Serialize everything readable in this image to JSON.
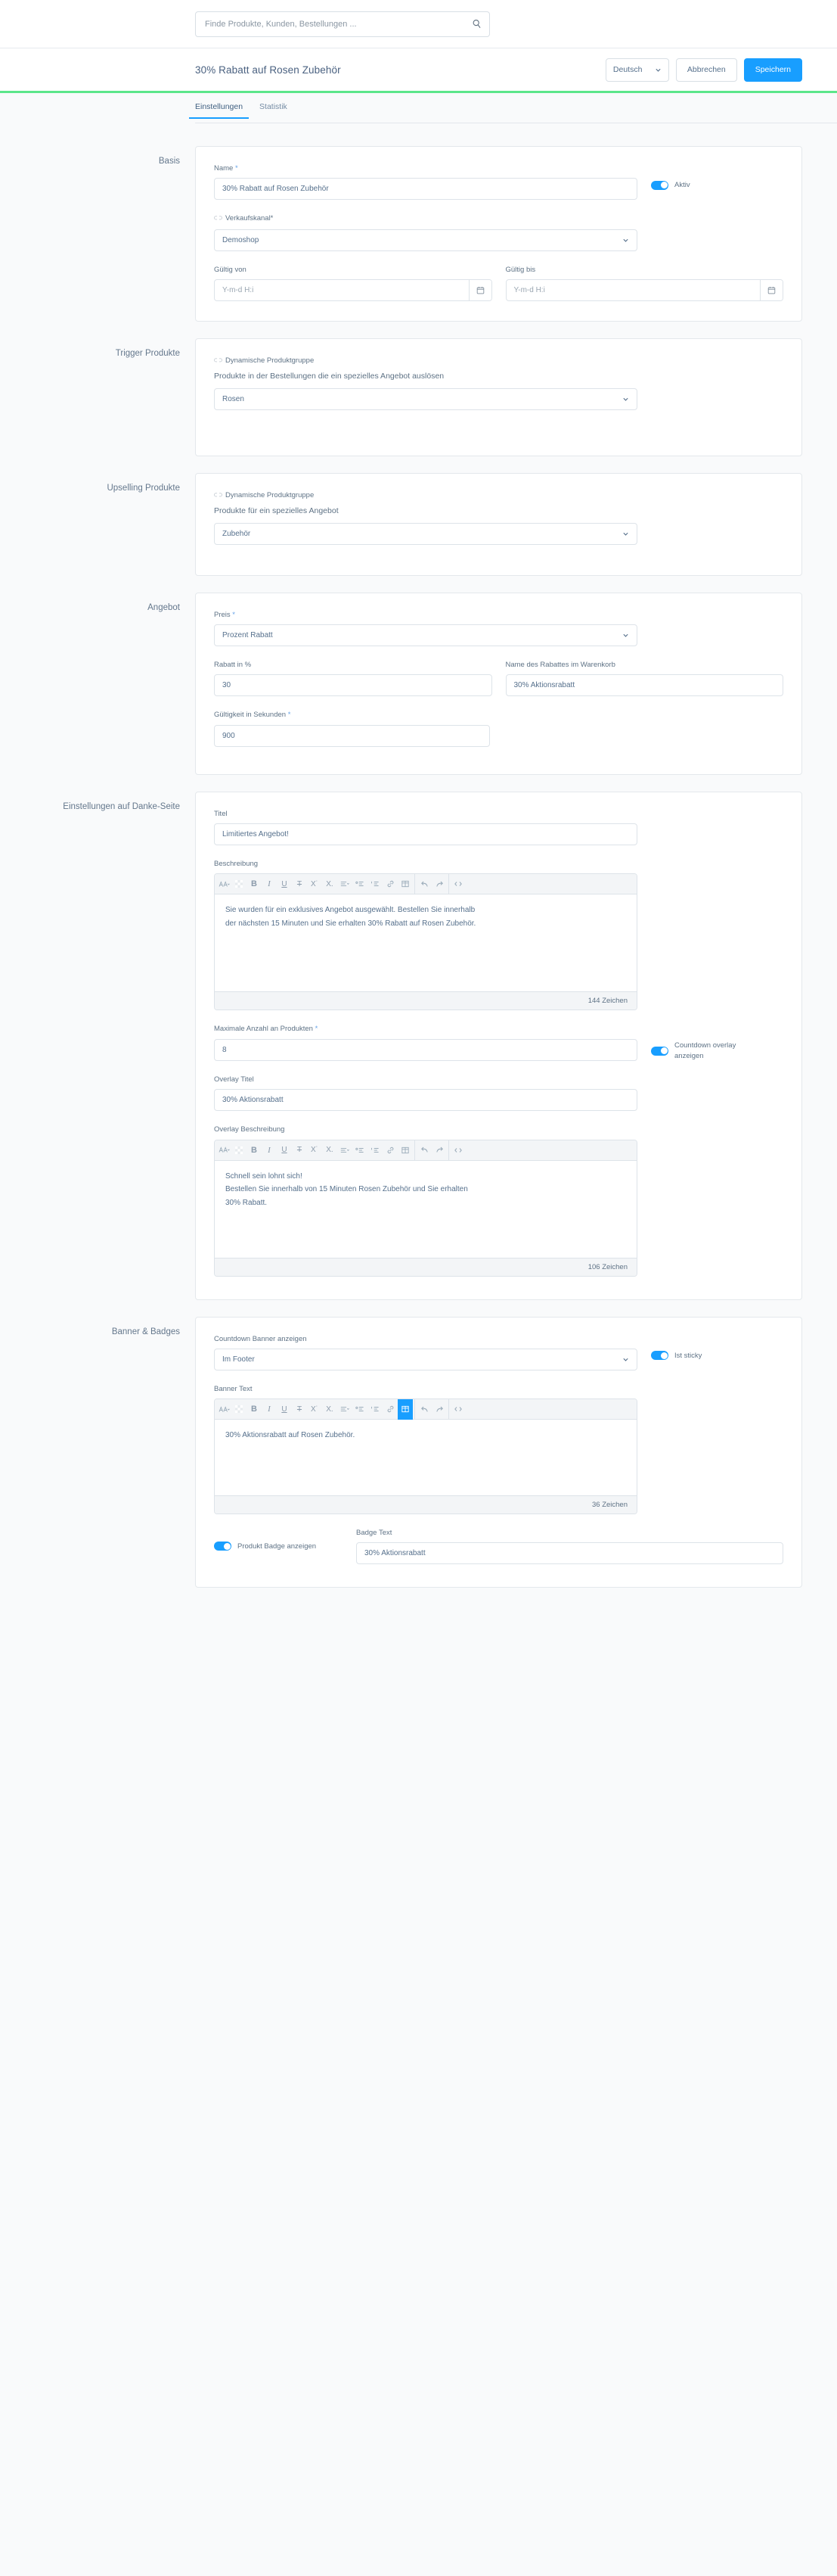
{
  "search": {
    "placeholder": "Finde Produkte, Kunden, Bestellungen ...",
    "icon": "search-icon"
  },
  "header": {
    "title": "30% Rabatt auf Rosen Zubehör",
    "language": "Deutsch",
    "cancel_label": "Abbrechen",
    "save_label": "Speichern",
    "accent_color": "#189eff",
    "status_bar_color": "#5ce68a"
  },
  "tabs": [
    {
      "label": "Einstellungen",
      "active": true
    },
    {
      "label": "Statistik",
      "active": false
    }
  ],
  "sections": {
    "basis": {
      "label": "Basis",
      "name_label": "Name",
      "name_value": "30% Rabatt auf Rosen Zubehör",
      "active_toggle_label": "Aktiv",
      "sales_channel_label": "Verkaufskanal*",
      "sales_channel_value": "Demoshop",
      "valid_from_label": "Gültig von",
      "valid_from_placeholder": "Y-m-d H:i",
      "valid_to_label": "Gültig bis",
      "valid_to_placeholder": "Y-m-d H:i"
    },
    "trigger": {
      "label": "Trigger Produkte",
      "inherit_label": "Dynamische Produktgruppe",
      "field_label": "Produkte in der Bestellungen die ein spezielles Angebot auslösen",
      "value": "Rosen"
    },
    "upselling": {
      "label": "Upselling Produkte",
      "inherit_label": "Dynamische Produktgruppe",
      "field_label": "Produkte für ein spezielles Angebot",
      "value": "Zubehör"
    },
    "angebot": {
      "label": "Angebot",
      "price_label": "Preis",
      "price_value": "Prozent Rabatt",
      "discount_label": "Rabatt in %",
      "discount_value": "30",
      "cart_name_label": "Name des Rabattes im Warenkorb",
      "cart_name_value": "30% Aktionsrabatt",
      "validity_label": "Gültigkeit in Sekunden",
      "validity_value": "900"
    },
    "thankyou": {
      "label": "Einstellungen auf Danke-Seite",
      "title_label": "Titel",
      "title_value": "Limitiertes Angebot!",
      "description_label": "Beschreibung",
      "description_line1": "Sie wurden für ein exklusives Angebot ausgewählt. Bestellen Sie innerhalb",
      "description_line2": "der nächsten 15 Minuten und Sie erhalten 30% Rabatt auf Rosen Zubehör.",
      "description_counter": "144 Zeichen",
      "max_products_label": "Maximale Anzahl an Produkten",
      "max_products_value": "8",
      "countdown_overlay_label": "Countdown overlay anzeigen",
      "overlay_title_label": "Overlay Titel",
      "overlay_title_value": "30% Aktionsrabatt",
      "overlay_desc_label": "Overlay Beschreibung",
      "overlay_desc_line1": "Schnell sein lohnt sich!",
      "overlay_desc_line2": "Bestellen Sie innerhalb von 15 Minuten Rosen Zubehör und Sie erhalten",
      "overlay_desc_line3": "30% Rabatt.",
      "overlay_desc_counter": "106 Zeichen"
    },
    "banner": {
      "label": "Banner & Badges",
      "countdown_banner_label": "Countdown Banner anzeigen",
      "countdown_banner_value": "Im Footer",
      "sticky_label": "Ist sticky",
      "banner_text_label": "Banner Text",
      "banner_text_value": "30% Aktionsrabatt auf Rosen Zubehör.",
      "banner_text_counter": "36 Zeichen",
      "product_badge_label": "Produkt Badge anzeigen",
      "badge_text_label": "Badge Text",
      "badge_text_value": "30% Aktionsrabatt"
    }
  },
  "editor_toolbar": [
    {
      "name": "font-format-icon",
      "glyph": "𝔸"
    },
    {
      "name": "text-color-icon",
      "glyph": "▨"
    },
    {
      "name": "bold-icon",
      "glyph": "B"
    },
    {
      "name": "italic-icon",
      "glyph": "I"
    },
    {
      "name": "underline-icon",
      "glyph": "U"
    },
    {
      "name": "strikethrough-icon",
      "glyph": "T"
    },
    {
      "name": "superscript-icon",
      "glyph": "X˙"
    },
    {
      "name": "subscript-icon",
      "glyph": "X."
    },
    {
      "name": "align-icon",
      "glyph": "≡"
    },
    {
      "name": "bullet-list-icon",
      "glyph": "⁐"
    },
    {
      "name": "numbered-list-icon",
      "glyph": "1≡"
    },
    {
      "name": "link-icon",
      "glyph": "⛓"
    },
    {
      "name": "table-icon",
      "glyph": "⊞"
    },
    {
      "name": "undo-icon",
      "glyph": "↩"
    },
    {
      "name": "redo-icon",
      "glyph": "↪"
    },
    {
      "name": "source-code-icon",
      "glyph": "‹›"
    }
  ]
}
